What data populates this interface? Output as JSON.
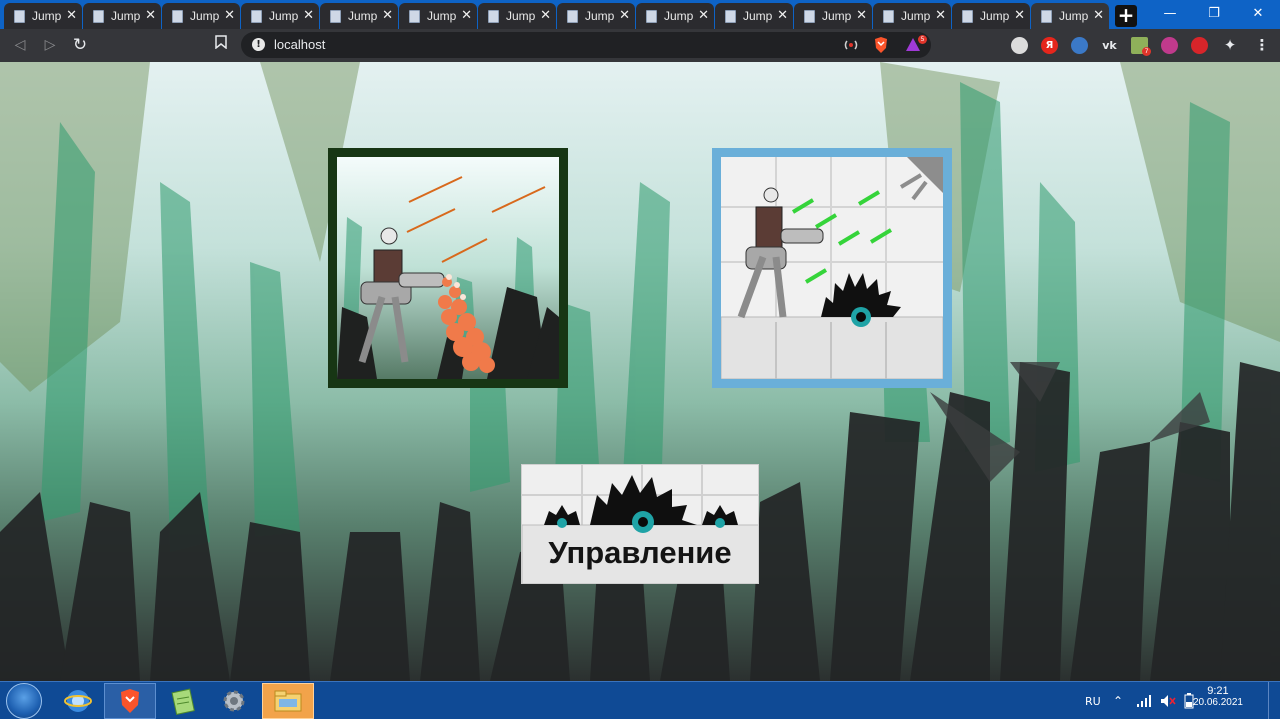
{
  "browser": {
    "tabs": [
      {
        "title": "Jump"
      },
      {
        "title": "Jump"
      },
      {
        "title": "Jump"
      },
      {
        "title": "Jump"
      },
      {
        "title": "Jump"
      },
      {
        "title": "Jump"
      },
      {
        "title": "Jump"
      },
      {
        "title": "Jump"
      },
      {
        "title": "Jump"
      },
      {
        "title": "Jump"
      },
      {
        "title": "Jump"
      },
      {
        "title": "Jump"
      },
      {
        "title": "Jump"
      },
      {
        "title": "Jump"
      }
    ],
    "active_tab_index": 13,
    "address": "localhost",
    "extension_badges": {
      "brave_rewards": "5",
      "ext_counter": "7"
    }
  },
  "page": {
    "level_cards": [
      {
        "name": "forest-level",
        "icon": "robot-firing-in-forest"
      },
      {
        "name": "lab-level",
        "icon": "robot-with-saw-in-lab"
      }
    ],
    "controls_button_label": "Управление"
  },
  "taskbar": {
    "language": "RU",
    "time": "9:21",
    "date": "20.06.2021"
  },
  "colors": {
    "tabstrip": "#0e63c6",
    "toolbar": "#35363a",
    "forest_card_border": "#173614",
    "lab_card_border": "#6aafd9",
    "taskbar": "#0f4a95"
  }
}
